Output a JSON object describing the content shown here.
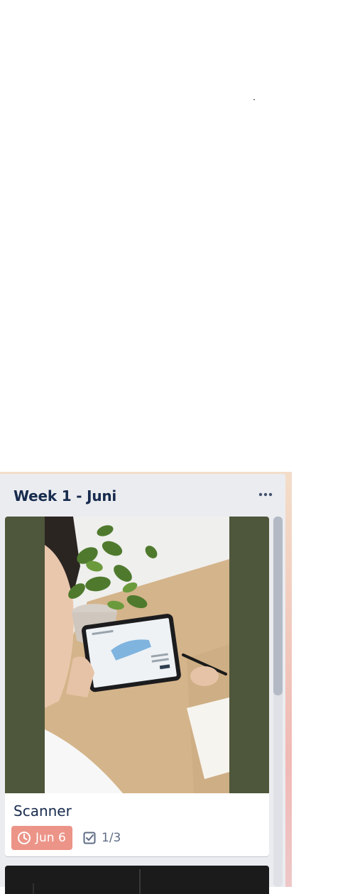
{
  "list": {
    "title": "Week 1 - Juni",
    "menu_icon": "ellipsis-icon"
  },
  "card": {
    "title": "Scanner",
    "due": {
      "icon": "clock-icon",
      "label": "Jun 6",
      "color": "#ec9488"
    },
    "checklist": {
      "icon": "checkbox-icon",
      "label": "1/3"
    },
    "cover_color": "#4e563b"
  },
  "colors": {
    "list_bg": "#ebecf0",
    "text": "#172b4d",
    "meta_text": "#5e6c84"
  }
}
